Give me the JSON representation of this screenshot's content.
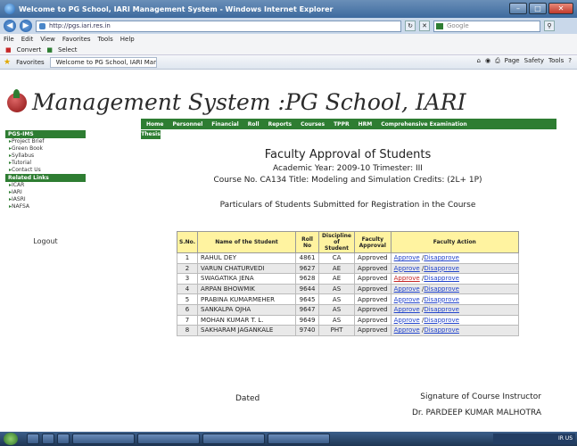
{
  "window": {
    "title": "Welcome to PG School, IARI Management System - Windows Internet Explorer",
    "address": "http://pgs.iari.res.in",
    "search_placeholder": "Google"
  },
  "menubar": [
    "File",
    "Edit",
    "View",
    "Favorites",
    "Tools",
    "Help"
  ],
  "linksbar": [
    "Convert",
    "Select"
  ],
  "favorites": {
    "label": "Favorites",
    "tab": "Welcome to PG School, IARI Management System",
    "commands": [
      "Page",
      "Safety",
      "Tools"
    ]
  },
  "site_title": "Management System :PG School, IARI",
  "sidebar": {
    "heading1": "PGS-IMS",
    "items1": [
      "Project Brief",
      "Green Book",
      "Syllabus",
      "Tutorial",
      "Contact Us"
    ],
    "heading2": "Related Links",
    "items2": [
      "ICAR",
      "IARI",
      "IASRI",
      "NAFSA"
    ],
    "logout": "Logout"
  },
  "nav": {
    "items": [
      "Home",
      "Personnel",
      "Financial",
      "Roll",
      "Reports",
      "Courses",
      "TPPR",
      "HRM",
      "Comprehensive Examination"
    ],
    "items2": [
      "Thesis"
    ]
  },
  "main": {
    "title": "Faculty Approval of Students",
    "year_line": "Academic Year: 2009-10 Trimester: III",
    "course_line": "Course No. CA134 Title: Modeling and Simulation Credits: (2L+ 1P)",
    "particulars": "Particulars of Students Submitted for Registration in the Course"
  },
  "table": {
    "headers": [
      "S.No.",
      "Name of the Student",
      "Roll No",
      "Discipline of Student",
      "Faculty Approval",
      "Faculty Action"
    ],
    "rows": [
      {
        "sno": "1",
        "name": "RAHUL DEY",
        "roll": "4861",
        "disc": "CA",
        "status": "Approved",
        "approve": "Approve",
        "disapprove": "Disapprove"
      },
      {
        "sno": "2",
        "name": "VARUN CHATURVEDI",
        "roll": "9627",
        "disc": "AE",
        "status": "Approved",
        "approve": "Approve",
        "disapprove": "Disapprove"
      },
      {
        "sno": "3",
        "name": "SWAGATIKA JENA",
        "roll": "9628",
        "disc": "AE",
        "status": "Approved",
        "approve": "Approve",
        "disapprove": "Disapprove"
      },
      {
        "sno": "4",
        "name": "ARPAN BHOWMIK",
        "roll": "9644",
        "disc": "AS",
        "status": "Approved",
        "approve": "Approve",
        "disapprove": "Disapprove"
      },
      {
        "sno": "5",
        "name": "PRABINA KUMARMEHER",
        "roll": "9645",
        "disc": "AS",
        "status": "Approved",
        "approve": "Approve",
        "disapprove": "Disapprove"
      },
      {
        "sno": "6",
        "name": "SANKALPA OJHA",
        "roll": "9647",
        "disc": "AS",
        "status": "Approved",
        "approve": "Approve",
        "disapprove": "Disapprove"
      },
      {
        "sno": "7",
        "name": "MOHAN KUMAR T. L.",
        "roll": "9649",
        "disc": "AS",
        "status": "Approved",
        "approve": "Approve",
        "disapprove": "Disapprove"
      },
      {
        "sno": "8",
        "name": "SAKHARAM JAGANKALE",
        "roll": "9740",
        "disc": "PHT",
        "status": "Approved",
        "approve": "Approve",
        "disapprove": "Disapprove"
      }
    ]
  },
  "footer": {
    "dated": "Dated",
    "signature": "Signature of Course Instructor",
    "instructor": "Dr. PARDEEP KUMAR MALHOTRA"
  },
  "taskbar": {
    "items": [
      "",
      "",
      "",
      "",
      "",
      "",
      "",
      "",
      ""
    ],
    "tray": "IR US"
  },
  "colors": {
    "nav_green": "#2e7d32",
    "table_header": "#fff3a0",
    "link": "#2244cc",
    "link_active": "#c62828"
  }
}
